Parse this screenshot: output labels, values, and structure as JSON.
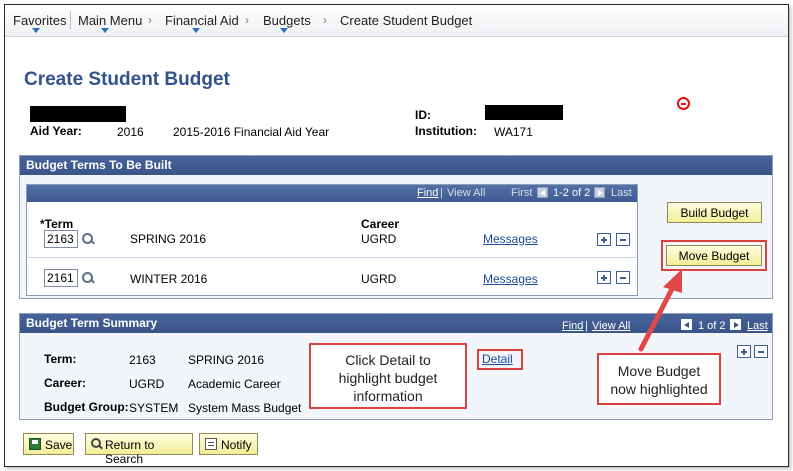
{
  "nav": {
    "items": [
      "Favorites",
      "Main Menu",
      "Financial Aid",
      "Budgets",
      "Create Student Budget"
    ]
  },
  "page": {
    "title": "Create Student Budget",
    "id_label": "ID:",
    "aid_year_label": "Aid Year:",
    "aid_year_value": "2016",
    "aid_year_desc": "2015-2016 Financial Aid Year",
    "institution_label": "Institution:",
    "institution_value": "WA171"
  },
  "budget_terms": {
    "header": "Budget Terms To Be Built",
    "find": "Find",
    "view_all": "View All",
    "first": "First",
    "range": "1-2 of 2",
    "last": "Last",
    "col_term": "*Term",
    "col_career": "Career",
    "rows": [
      {
        "term": "2163",
        "term_desc": "SPRING 2016",
        "career": "UGRD",
        "messages": "Messages"
      },
      {
        "term": "2161",
        "term_desc": "WINTER 2016",
        "career": "UGRD",
        "messages": "Messages"
      }
    ],
    "build_budget": "Build Budget",
    "move_budget": "Move Budget"
  },
  "summary": {
    "header": "Budget Term Summary",
    "find": "Find",
    "view_all": "View All",
    "first": "First",
    "range": "1 of 2",
    "last": "Last",
    "term_label": "Term:",
    "term_value": "2163",
    "term_desc": "SPRING 2016",
    "career_label": "Career:",
    "career_value": "UGRD",
    "career_desc": "Academic Career",
    "group_label": "Budget Group:",
    "group_value": "SYSTEM",
    "group_desc": "System Mass Budget",
    "detail": "Detail"
  },
  "callouts": {
    "detail_note": [
      "Click Detail to",
      "highlight budget",
      "information"
    ],
    "move_note": [
      "Move Budget",
      "now highlighted"
    ]
  },
  "footer": {
    "save": "Save",
    "return": "Return to Search",
    "notify": "Notify"
  },
  "colors": {
    "header_blue": "#3a5488",
    "title_blue": "#32528f",
    "callout_red": "#d94040",
    "button_yellow": "#f3ee98"
  }
}
